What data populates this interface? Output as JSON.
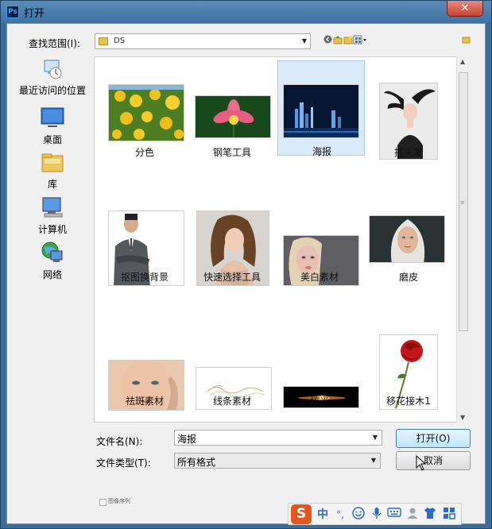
{
  "app": {
    "icon_text": "Ps",
    "title": "打开",
    "close_symbol": "✕"
  },
  "toolbar": {
    "lookin_label": "查找范围(I):",
    "lookin_value": "DS"
  },
  "places": [
    {
      "label": "最近访问的位置",
      "icon": "recent-places-icon"
    },
    {
      "label": "桌面",
      "icon": "desktop-icon"
    },
    {
      "label": "库",
      "icon": "library-icon"
    },
    {
      "label": "计算机",
      "icon": "computer-icon"
    },
    {
      "label": "网络",
      "icon": "network-icon"
    }
  ],
  "files": [
    {
      "name": "分色",
      "selected": false
    },
    {
      "name": "钢笔工具",
      "selected": false
    },
    {
      "name": "海报",
      "selected": true
    },
    {
      "name": "抠头发",
      "selected": false
    },
    {
      "name": "抠图换背景",
      "selected": false
    },
    {
      "name": "快速选择工具",
      "selected": false
    },
    {
      "name": "美白素材",
      "selected": false
    },
    {
      "name": "磨皮",
      "selected": false
    },
    {
      "name": "祛斑素材",
      "selected": false
    },
    {
      "name": "线条素材",
      "selected": false
    },
    {
      "name": "炫光",
      "selected": false
    },
    {
      "name": "移花接木1",
      "selected": false
    }
  ],
  "form": {
    "filename_label": "文件名(N):",
    "filename_value": "海报",
    "filetype_label": "文件类型(T):",
    "filetype_value": "所有格式",
    "open_button": "打开(O)",
    "cancel_button": "取消",
    "image_sequence_label": "图像序列"
  },
  "ime": {
    "logo": "S",
    "mode": "中",
    "punct": "°,"
  },
  "colors": {
    "titlebar": "#4a7fb0",
    "selection": "#dcebfc",
    "close": "#c64433",
    "ime_logo": "#e6541f"
  }
}
